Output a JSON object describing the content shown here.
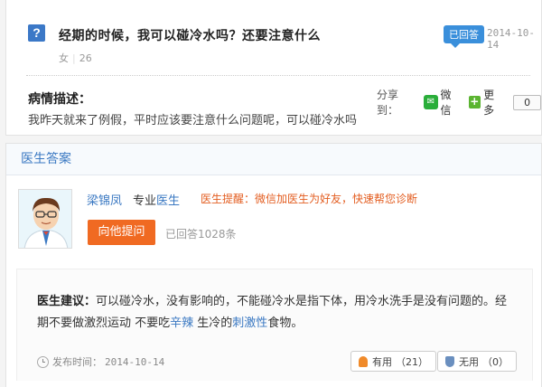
{
  "question": {
    "icon_char": "?",
    "title": "经期的时候，我可以碰冷水吗？还要注意什么",
    "gender": "女",
    "age": "26",
    "status_badge": "已回答",
    "date": "2014-10-14",
    "desc_label": "病情描述：",
    "desc_text": "我昨天就来了例假，平时应该要注意什么问题呢，可以碰冷水吗"
  },
  "share": {
    "label": "分享到：",
    "wechat_label": "微信",
    "wechat_icon_char": "✉",
    "more_icon_char": "+",
    "more_label": "更多",
    "count": "0"
  },
  "answer": {
    "section_title": "医生答案",
    "doctor_name": "梁锦凤",
    "doctor_title_prefix": "专业",
    "doctor_dept": "医生",
    "tip": "医生提醒：微信加医生为好友，快速帮您诊断",
    "ask_button": "向他提问",
    "answered_count": "已回答1028条",
    "advice_label": "医生建议：",
    "advice_part1": "可以碰冷水，没有影响的，不能碰冷水是指下体，用冷水洗手是没有问题的。经期不要做激烈运动 不要吃",
    "advice_kw1": "辛辣",
    "advice_part2": " 生冷的",
    "advice_kw2": "刺激性",
    "advice_part3": "食物。",
    "publish_label": "发布时间：",
    "publish_date": "2014-10-14",
    "useful_label": "有用",
    "useful_count": "（21）",
    "useless_label": "无用",
    "useless_count": "（0）"
  },
  "colors": {
    "accent_blue": "#3a78c2",
    "orange": "#f06a22",
    "tip_orange": "#e35d20",
    "wechat_green": "#2aae3a"
  }
}
